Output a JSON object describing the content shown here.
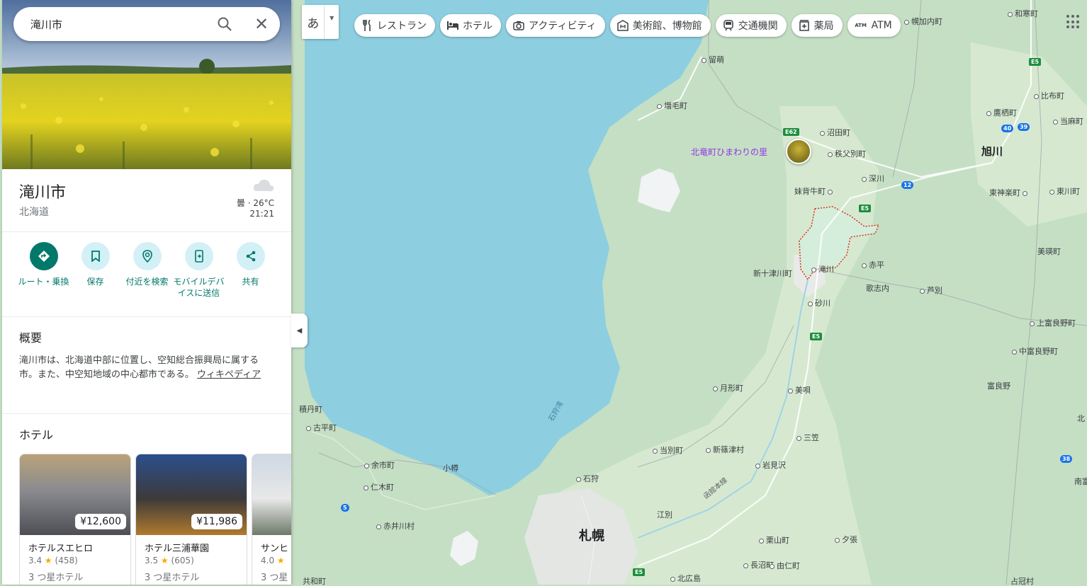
{
  "search": {
    "query": "滝川市"
  },
  "place": {
    "name": "滝川市",
    "region": "北海道",
    "weather": {
      "condition_temp": "曇 · 26°C",
      "time": "21:21"
    }
  },
  "actions": [
    {
      "label": "ルート・乗換",
      "icon": "directions-icon"
    },
    {
      "label": "保存",
      "icon": "bookmark-icon"
    },
    {
      "label": "付近を検索",
      "icon": "nearby-search-icon"
    },
    {
      "label": "モバイルデバイスに送信",
      "icon": "send-to-phone-icon"
    },
    {
      "label": "共有",
      "icon": "share-icon"
    }
  ],
  "overview": {
    "heading": "概要",
    "text": "滝川市は、北海道中部に位置し、空知総合振興局に属する市。また、中空知地域の中心都市である。",
    "link": "ウィキペディア"
  },
  "hotels": {
    "heading": "ホテル",
    "items": [
      {
        "name": "ホテルスエヒロ",
        "price": "¥12,600",
        "rating": "3.4",
        "reviews": "(458)",
        "class": "3 つ星ホテル"
      },
      {
        "name": "ホテル三浦華園",
        "price": "¥11,986",
        "rating": "3.5",
        "reviews": "(605)",
        "class": "3 つ星ホテル"
      },
      {
        "name": "サンヒ",
        "price": "",
        "rating": "4.0",
        "reviews": "",
        "class": "3 つ星"
      }
    ]
  },
  "ime": {
    "label": "あ"
  },
  "chips": [
    {
      "label": "レストラン",
      "icon": "restaurant-icon"
    },
    {
      "label": "ホテル",
      "icon": "hotel-icon"
    },
    {
      "label": "アクティビティ",
      "icon": "camera-icon"
    },
    {
      "label": "美術館、博物館",
      "icon": "museum-icon"
    },
    {
      "label": "交通機関",
      "icon": "transit-icon"
    },
    {
      "label": "薬局",
      "icon": "pharmacy-icon"
    },
    {
      "label": "ATM",
      "icon": "atm-icon"
    }
  ],
  "map": {
    "places": {
      "horokanai": "幌加内町",
      "wassamu": "和寒町",
      "rumoi": "留萌",
      "mashike": "増毛町",
      "numata": "沼田町",
      "chippubetsu": "秩父別町",
      "hokuryu_poi": "北竜町ひまわりの里",
      "fukagawa": "深川",
      "moseushi": "妹背牛町",
      "takikawa": "滝川",
      "shintotsukawa": "新十津川町",
      "akabira": "赤平",
      "utashinai": "歌志内",
      "ashibetsu": "芦別",
      "sunagawa": "砂川",
      "takasu": "鷹栖町",
      "pippu": "比布町",
      "toma": "当麻町",
      "asahikawa": "旭川",
      "higashikagura": "東神楽町",
      "higashikawa": "東川町",
      "biei": "美瑛町",
      "kamifurano": "上富良野町",
      "nakafurano": "中富良野町",
      "furano": "富良野",
      "tsukigata": "月形町",
      "bibai": "美唄",
      "mikasa": "三笠",
      "tobetsu": "当別町",
      "shinshinotsu": "新篠津村",
      "iwamizawa": "岩見沢",
      "shakotan": "積丹町",
      "furubira": "古平町",
      "yoichi": "余市町",
      "otaru": "小樽",
      "niki": "仁木町",
      "ishikari": "石狩",
      "sapporo": "札幌",
      "ebetsu": "江別",
      "akaigawa": "赤井川村",
      "kuriyama": "栗山町",
      "yubari": "夕張",
      "naganuma": "長沼町",
      "yuni": "由仁町",
      "kitahiroshima": "北広島",
      "kyowa": "共和町",
      "shimukappu": "占冠村",
      "minamifurano": "南富",
      "kita_edge": "北",
      "ishikari_bay": "石狩湾",
      "hakodate_line": "函館本線"
    },
    "shields": [
      "E5",
      "E62",
      "E5",
      "E5",
      "40",
      "39",
      "12",
      "5",
      "38",
      "E5"
    ],
    "colors": {
      "land": "#c5dfc4",
      "water": "#8dcfe0",
      "city": "#e3e6e3",
      "boundary": "#d93025"
    }
  }
}
